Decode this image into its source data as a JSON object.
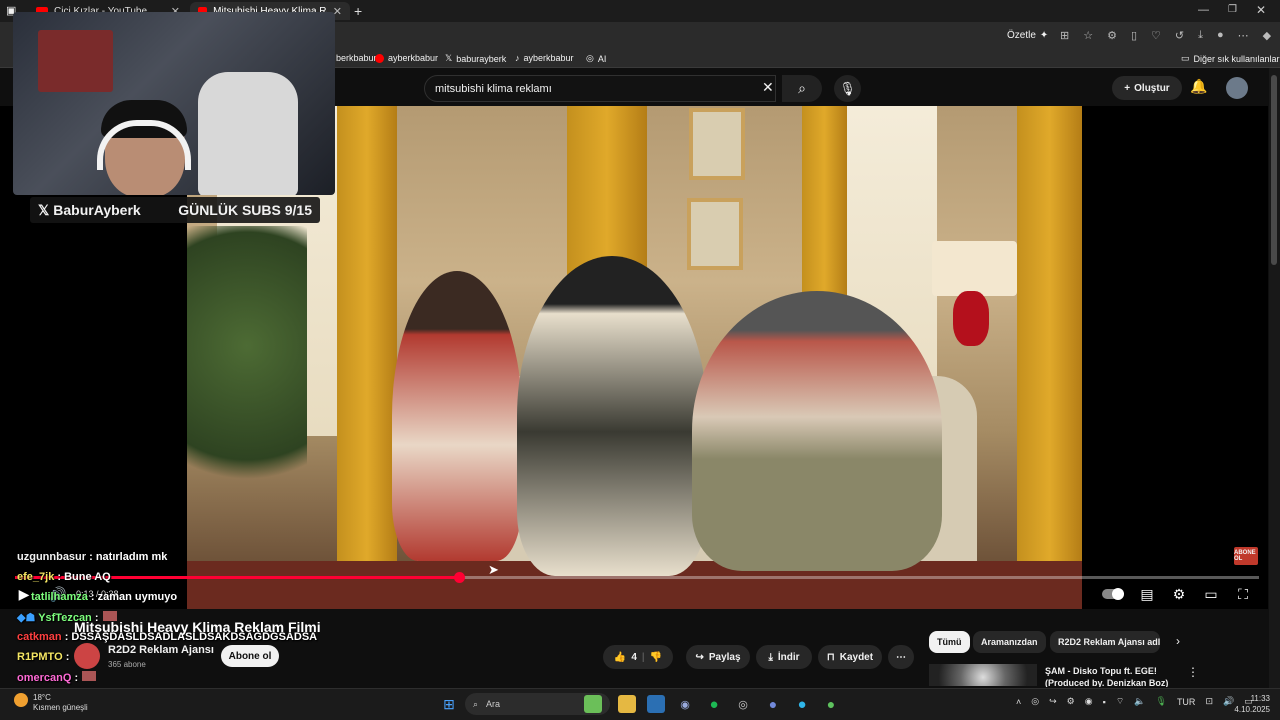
{
  "tabs": [
    {
      "label": "Cici Kızlar - YouTube"
    },
    {
      "label": "Mitsubishi Heavy Klima Reklam F"
    }
  ],
  "address": {
    "summarize_label": "Özetle"
  },
  "bookmarks": [
    {
      "label": "berkbabur"
    },
    {
      "label": "ayberkbabur"
    },
    {
      "label": "baburayberk"
    },
    {
      "label": "ayberkbabur"
    },
    {
      "label": "AI"
    }
  ],
  "other_favorites": "Diğer sık kullanılanlar",
  "search": {
    "value": "mitsubishi klima reklamı"
  },
  "create_label": "Oluştur",
  "overlay": {
    "handle": "BaburAyberk",
    "subs_goal": "GÜNLÜK SUBS 9/15"
  },
  "chat": [
    {
      "user": "uzgunnbasur",
      "message": " : natırladım mk",
      "color": "#f1f1f1"
    },
    {
      "user": "efe_7jk",
      "message": " : Bune AQ",
      "color": "#f5e663"
    },
    {
      "user": "tatlilhamza",
      "message": " : zaman uymuyo",
      "color": "#7dff7d"
    },
    {
      "user": "YsfTezcan",
      "message": " :",
      "color": "#7dff7d"
    },
    {
      "user": "catkman",
      "message": " : DSSAŞDASLDSADLASLDSAKDSAGDGSADSA",
      "color": "#ff4040"
    },
    {
      "user": "R1PMTO",
      "message": " :",
      "color": "#f5e663"
    },
    {
      "user": "omercanQ",
      "message": " :",
      "color": "#ff6ad5"
    }
  ],
  "player": {
    "time": "0:13 / 0:38",
    "progress": 0.357,
    "watermark": "ABONE OL"
  },
  "video": {
    "title": "Mitsubishi Heavy Klima Reklam Filmi",
    "channel": "R2D2 Reklam Ajansı",
    "subscribers": "365 abone",
    "subscribe_label": "Abone ol",
    "likes": "4",
    "share_label": "Paylaş",
    "download_label": "İndir",
    "save_label": "Kaydet"
  },
  "chips": [
    "Tümü",
    "Aramanızdan",
    "R2D2 Reklam Ajansı adl"
  ],
  "recommendation": {
    "title": "ŞAM - Disko Topu ft. EGE! (Produced by. Denizkan Boz)"
  },
  "taskbar": {
    "temp": "18°C",
    "weather": "Kısmen güneşli",
    "search_label": "Ara",
    "lang": "TUR",
    "time": "11:33",
    "date": "4.10.2025"
  }
}
